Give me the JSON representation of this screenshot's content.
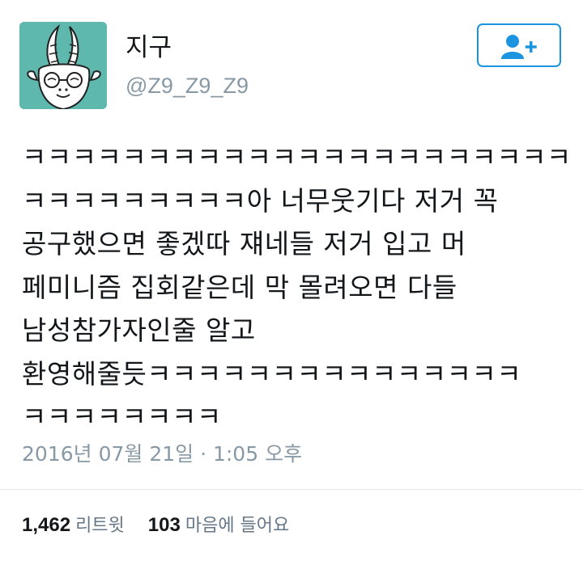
{
  "user": {
    "display_name": "지구",
    "handle": "@Z9_Z9_Z9"
  },
  "follow_button": {
    "icon": "follow-user-plus-icon"
  },
  "tweet": {
    "lines": [
      "ㅋㅋㅋㅋㅋㅋㅋㅋㅋㅋㅋㅋㅋㅋㅋㅋㅋㅋㅋㅋㅋㅋ",
      "ㅋㅋㅋㅋㅋㅋㅋㅋㅋ아 너무웃기다 저거 꼭",
      "공구했으면 좋겠따 쟤네들 저거 입고 머",
      "페미니즘 집회같은데 막 몰려오면 다들",
      "남성참가자인줄 알고",
      "환영해줄듯ㅋㅋㅋㅋㅋㅋㅋㅋㅋㅋㅋㅋㅋㅋㅋ",
      "ㅋㅋㅋㅋㅋㅋㅋㅋ"
    ],
    "timestamp": "2016년 07월 21일 · 1:05 오후"
  },
  "stats": {
    "retweets_count": "1,462",
    "retweets_label": "리트윗",
    "likes_count": "103",
    "likes_label": "마음에 들어요"
  },
  "colors": {
    "accent": "#1b95e0",
    "secondary_text": "#8899a6",
    "avatar_bg": "#5fb8ad"
  }
}
